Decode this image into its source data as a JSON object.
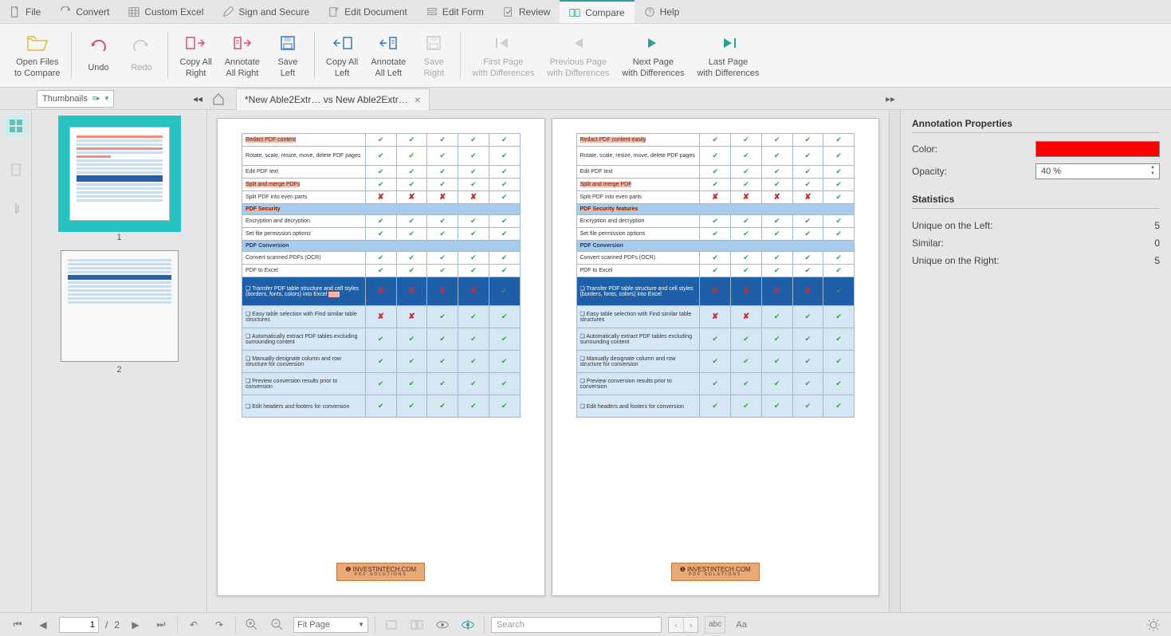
{
  "menu": {
    "items": [
      {
        "label": "File"
      },
      {
        "label": "Convert"
      },
      {
        "label": "Custom Excel"
      },
      {
        "label": "Sign and Secure"
      },
      {
        "label": "Edit Document"
      },
      {
        "label": "Edit Form"
      },
      {
        "label": "Review"
      },
      {
        "label": "Compare"
      },
      {
        "label": "Help"
      }
    ]
  },
  "ribbon": {
    "open_files": "Open Files\nto Compare",
    "undo": "Undo",
    "redo": "Redo",
    "copy_all_right": "Copy All\nRight",
    "annotate_all_right": "Annotate\nAll Right",
    "save_left": "Save\nLeft",
    "copy_all_left": "Copy All\nLeft",
    "annotate_all_left": "Annotate\nAll Left",
    "save_right": "Save\nRight",
    "first_page": "First Page\nwith Differences",
    "prev_page": "Previous Page\nwith Differences",
    "next_page": "Next Page\nwith Differences",
    "last_page": "Last Page\nwith Differences"
  },
  "tab": {
    "title": "*New Able2Extr… vs New Able2Extr…"
  },
  "thumbnails": {
    "select_label": "Thumbnails",
    "items": [
      "1",
      "2"
    ]
  },
  "pages": {
    "left": {
      "rows": [
        {
          "type": "row",
          "label": "Redact PDF content",
          "highlight": true,
          "checks": [
            "g",
            "g",
            "g",
            "g",
            "g"
          ]
        },
        {
          "type": "row",
          "label": "Rotate, scale, resize, move, delete PDF pages",
          "tall": true,
          "checks": [
            "g",
            "g",
            "g",
            "g",
            "g"
          ]
        },
        {
          "type": "row",
          "label": "Edit PDF text",
          "checks": [
            "g",
            "g",
            "g",
            "g",
            "g"
          ]
        },
        {
          "type": "row",
          "label": "Split and merge PDFs",
          "highlight": true,
          "checks": [
            "g",
            "g",
            "g",
            "g",
            "g"
          ]
        },
        {
          "type": "row",
          "label": "Split PDF into even parts",
          "checks": [
            "r",
            "r",
            "r",
            "r",
            "g"
          ]
        },
        {
          "type": "header",
          "label": "PDF Security",
          "highlight": true
        },
        {
          "type": "row",
          "label": "Encryption and decryption",
          "checks": [
            "g",
            "g",
            "g",
            "g",
            "g"
          ]
        },
        {
          "type": "row",
          "label": "Set file permission options",
          "checks": [
            "g",
            "g",
            "g",
            "g",
            "g"
          ]
        },
        {
          "type": "header",
          "label": "PDF Conversion"
        },
        {
          "type": "row",
          "label": "Convert scanned PDFs (OCR)",
          "checks": [
            "g",
            "g",
            "g",
            "g",
            "g"
          ]
        },
        {
          "type": "row",
          "label": "PDF to Excel",
          "checks": [
            "g",
            "g",
            "g",
            "g",
            "g"
          ]
        },
        {
          "type": "row-dark",
          "label": "Transfer PDF table structure and cell styles (borders, fonts, colors) into Excel",
          "highlight_tail": true,
          "checks": [
            "r",
            "r",
            "r",
            "r",
            "g"
          ]
        },
        {
          "type": "row-light",
          "label": "Easy table selection with Find similar table structures",
          "checks": [
            "r",
            "r",
            "g",
            "g",
            "g"
          ]
        },
        {
          "type": "row-light",
          "label": "Automatically extract PDF tables excluding surrounding content",
          "checks": [
            "g",
            "g",
            "g",
            "g",
            "g"
          ]
        },
        {
          "type": "row-light",
          "label": "Manually designate column and row structure for conversion",
          "checks": [
            "g",
            "g",
            "g",
            "g",
            "g"
          ]
        },
        {
          "type": "row-light",
          "label": "Preview conversion results prior to conversion",
          "checks": [
            "g",
            "g",
            "g",
            "g",
            "g"
          ]
        },
        {
          "type": "row-light",
          "label": "Edit headers and footers for conversion",
          "checks": [
            "g",
            "g",
            "g",
            "g",
            "g"
          ]
        }
      ],
      "brand": "INVESTINTECH.COM",
      "brand_sub": "PDF SOLUTIONS"
    },
    "right": {
      "rows": [
        {
          "type": "row",
          "label": "Redact PDF content easily",
          "highlight": true,
          "checks": [
            "g",
            "g",
            "g",
            "g",
            "g"
          ]
        },
        {
          "type": "row",
          "label": "Rotate, scale, resize, move, delete PDF pages",
          "tall": true,
          "checks": [
            "g",
            "g",
            "g",
            "g",
            "g"
          ]
        },
        {
          "type": "row",
          "label": "Edit PDF text",
          "checks": [
            "g",
            "g",
            "g",
            "g",
            "g"
          ]
        },
        {
          "type": "row",
          "label": "Split and merge PDF",
          "highlight": true,
          "checks": [
            "g",
            "g",
            "g",
            "g",
            "g"
          ]
        },
        {
          "type": "row",
          "label": "Split PDF into even parts",
          "checks": [
            "r",
            "r",
            "r",
            "r",
            "g"
          ]
        },
        {
          "type": "header",
          "label": "PDF Security features",
          "highlight": true
        },
        {
          "type": "row",
          "label": "Encryption and decryption",
          "checks": [
            "g",
            "g",
            "g",
            "g",
            "g"
          ]
        },
        {
          "type": "row",
          "label": "Set file permission options",
          "checks": [
            "g",
            "g",
            "g",
            "g",
            "g"
          ]
        },
        {
          "type": "header",
          "label": "PDF Conversion"
        },
        {
          "type": "row",
          "label": "Convert scanned PDFs (OCR)",
          "checks": [
            "g",
            "g",
            "g",
            "g",
            "g"
          ]
        },
        {
          "type": "row",
          "label": "PDF to Excel",
          "checks": [
            "g",
            "g",
            "g",
            "g",
            "g"
          ]
        },
        {
          "type": "row-dark",
          "label": "Transfer PDF table structure and cell styles (borders, fonts, colors) into Excel",
          "checks": [
            "r",
            "r",
            "r",
            "r",
            "g"
          ]
        },
        {
          "type": "row-light",
          "label": "Easy table selection with Find similar table structures",
          "checks": [
            "r",
            "r",
            "g",
            "g",
            "g"
          ]
        },
        {
          "type": "row-light",
          "label": "Automatically extract PDF tables excluding surrounding content",
          "checks": [
            "g",
            "g",
            "g",
            "g",
            "g"
          ]
        },
        {
          "type": "row-light",
          "label": "Manually designate column and row structure for conversion",
          "checks": [
            "g",
            "g",
            "g",
            "g",
            "g"
          ]
        },
        {
          "type": "row-light",
          "label": "Preview conversion results prior to conversion",
          "checks": [
            "g",
            "g",
            "g",
            "g",
            "g"
          ]
        },
        {
          "type": "row-light",
          "label": "Edit headers and footers for conversion",
          "checks": [
            "g",
            "g",
            "g",
            "g",
            "g"
          ]
        }
      ],
      "brand": "INVESTINTECH.COM",
      "brand_sub": "PDF SOLUTIONS"
    }
  },
  "panel": {
    "title": "Annotation Properties",
    "color_label": "Color:",
    "color_value": "#ff0000",
    "opacity_label": "Opacity:",
    "opacity_value": "40 %",
    "stats_title": "Statistics",
    "unique_left_label": "Unique on the Left:",
    "unique_left_value": "5",
    "similar_label": "Similar:",
    "similar_value": "0",
    "unique_right_label": "Unique on the Right:",
    "unique_right_value": "5"
  },
  "status": {
    "page_current": "1",
    "page_total": "2",
    "zoom_mode": "Fit Page",
    "search_placeholder": "Search"
  }
}
